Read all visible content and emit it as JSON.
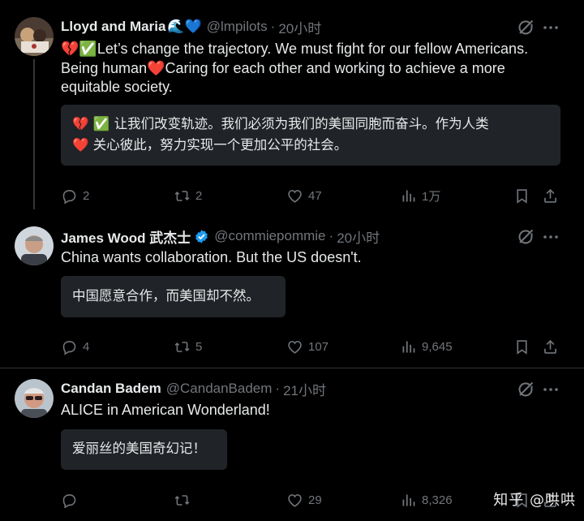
{
  "tweets": [
    {
      "name": "Lloyd and Maria",
      "name_emoji": "🌊💙",
      "handle": "@lmpilots",
      "time": "20小时",
      "text_line1": "💔✅Let’s change the trajectory. We must fight for our fellow Americans.",
      "text_line2": "Being human❤️Caring for each other and working to achieve a more",
      "text_line3": "equitable society.",
      "translation_line1": "💔 ✅ 让我们改变轨迹。我们必须为我们的美国同胞而奋斗。作为人类",
      "translation_line2": "❤️ 关心彼此，努力实现一个更加公平的社会。",
      "replies": "2",
      "retweets": "2",
      "likes": "47",
      "views": "1万"
    },
    {
      "name": "James Wood 武杰士",
      "handle": "@commiepommie",
      "time": "20小时",
      "text_line1": "China wants collaboration. But the US doesn't.",
      "translation_line1": "中国愿意合作，而美国却不然。",
      "replies": "4",
      "retweets": "5",
      "likes": "107",
      "views": "9,645"
    },
    {
      "name": "Candan Badem",
      "handle": "@CandanBadem",
      "time": "21小时",
      "text_line1": "ALICE in American Wonderland!",
      "translation_line1": "爱丽丝的美国奇幻记！",
      "replies": "",
      "retweets": "",
      "likes": "29",
      "views": "8,326"
    }
  ],
  "watermark": "知乎 @哄哄",
  "colors": {
    "background": "#000000",
    "text": "#e7e9ea",
    "muted": "#71767b",
    "translation_bg": "#202327",
    "verified": "#1d9bf0"
  },
  "icons": [
    "reply-icon",
    "retweet-icon",
    "like-icon",
    "views-icon",
    "bookmark-icon",
    "share-icon",
    "grok-icon",
    "more-icon",
    "verified-badge-icon"
  ]
}
